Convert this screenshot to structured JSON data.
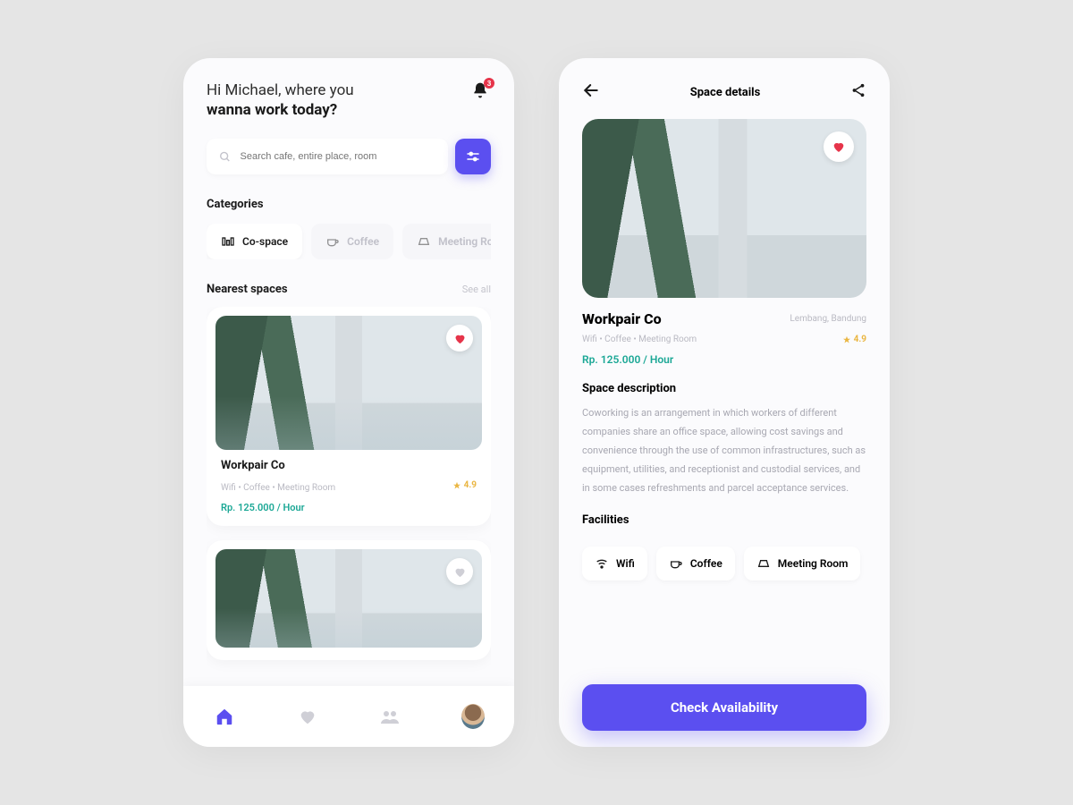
{
  "colors": {
    "accent": "#5b4ff0",
    "price": "#1aa795",
    "rating": "#eab642",
    "heart": "#e6344a"
  },
  "home": {
    "greeting_line1": "Hi Michael, where you",
    "greeting_line2": "wanna work today?",
    "notification_count": "3",
    "search_placeholder": "Search cafe, entire place, room",
    "categories_title": "Categories",
    "categories": [
      {
        "icon": "cospace",
        "label": "Co-space"
      },
      {
        "icon": "coffee",
        "label": "Coffee"
      },
      {
        "icon": "meeting",
        "label": "Meeting Room"
      }
    ],
    "nearest_title": "Nearest spaces",
    "see_all": "See all",
    "cards": [
      {
        "title": "Workpair Co",
        "amenities": "Wifi • Coffee • Meeting Room",
        "price": "Rp. 125.000 / Hour",
        "rating": "4.9",
        "favorited": true
      },
      {
        "favorited": false
      }
    ]
  },
  "details": {
    "topbar_title": "Space details",
    "title": "Workpair Co",
    "location": "Lembang, Bandung",
    "amenities": "Wifi • Coffee • Meeting Room",
    "rating": "4.9",
    "price": "Rp. 125.000 / Hour",
    "desc_heading": "Space description",
    "description": "Coworking is an arrangement in which workers of different companies share an office space, allowing cost savings and convenience through the use of common infrastructures, such as equipment, utilities, and receptionist and custodial services, and in some cases refreshments and parcel acceptance services.",
    "facilities_heading": "Facilities",
    "facilities": [
      {
        "icon": "wifi",
        "label": "Wifi"
      },
      {
        "icon": "coffee",
        "label": "Coffee"
      },
      {
        "icon": "meeting",
        "label": "Meeting Room"
      }
    ],
    "cta": "Check Availability"
  }
}
